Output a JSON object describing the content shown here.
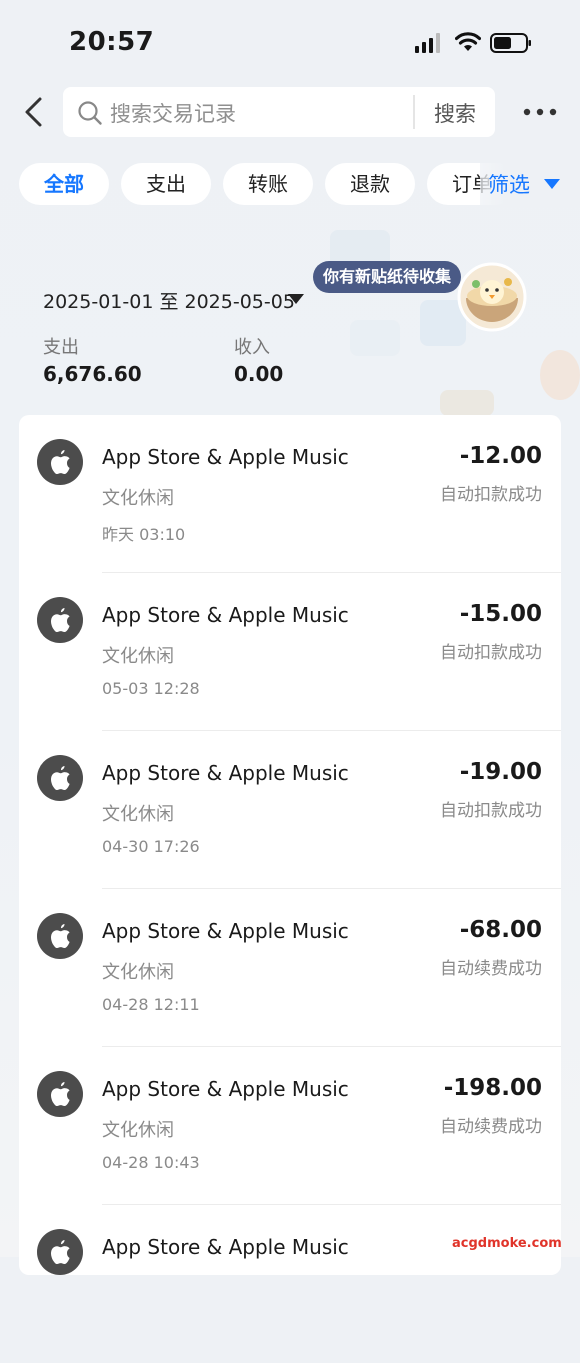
{
  "status_bar": {
    "time": "20:57"
  },
  "header": {
    "search_placeholder": "搜索交易记录",
    "search_button": "搜索"
  },
  "tabs": [
    "全部",
    "支出",
    "转账",
    "退款",
    "订单"
  ],
  "filter_label": "筛选",
  "summary": {
    "date_range": "2025-01-01 至 2025-05-05",
    "sticker_text": "你有新贴纸待收集",
    "expense_label": "支出",
    "expense_value": "6,676.60",
    "income_label": "收入",
    "income_value": "0.00"
  },
  "transactions": [
    {
      "merchant": "App Store & Apple Music",
      "category": "文化休闲",
      "time": "昨天 03:10",
      "amount": "-12.00",
      "status": "自动扣款成功"
    },
    {
      "merchant": "App Store & Apple Music",
      "category": "文化休闲",
      "time": "05-03 12:28",
      "amount": "-15.00",
      "status": "自动扣款成功"
    },
    {
      "merchant": "App Store & Apple Music",
      "category": "文化休闲",
      "time": "04-30 17:26",
      "amount": "-19.00",
      "status": "自动扣款成功"
    },
    {
      "merchant": "App Store & Apple Music",
      "category": "文化休闲",
      "time": "04-28 12:11",
      "amount": "-68.00",
      "status": "自动续费成功"
    },
    {
      "merchant": "App Store & Apple Music",
      "category": "文化休闲",
      "time": "04-28 10:43",
      "amount": "-198.00",
      "status": "自动续费成功"
    },
    {
      "merchant": "App Store & Apple Music",
      "category": "",
      "time": "",
      "amount": "",
      "status": ""
    }
  ],
  "watermark": "acgdmoke.com",
  "colors": {
    "accent": "#1677ff",
    "sticker_bg": "#4a5a86",
    "avatar_bg": "#4c4c4c"
  }
}
